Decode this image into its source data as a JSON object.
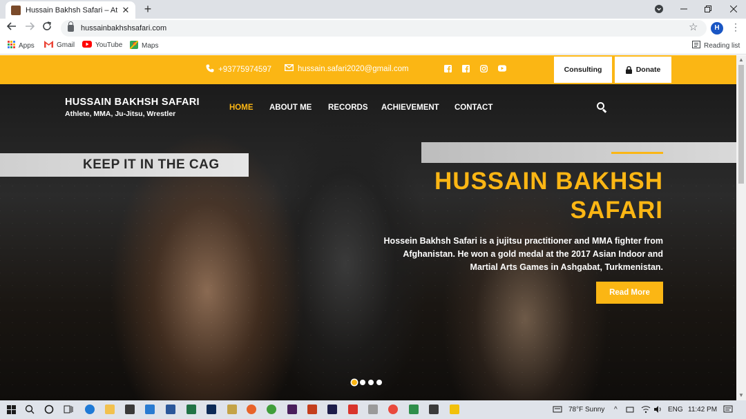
{
  "browser": {
    "tab_title": "Hussain Bakhsh Safari – Athlete, MMA, Ju-Jitsu, Wrestler",
    "tab_close": "✕",
    "new_tab": "+",
    "url": "hussainbakhshsafari.com",
    "profile_initial": "H",
    "bookmarks": [
      "Apps",
      "Gmail",
      "YouTube",
      "Maps"
    ],
    "reading_list": "Reading list"
  },
  "site": {
    "phone": "+93775974597",
    "email": "hussain.safari2020@gmail.com",
    "consulting_label": "Consulting",
    "donate_label": "Donate",
    "brand_name": "HUSSAIN BAKHSH SAFARI",
    "brand_tagline": "Athlete, MMA, Ju-Jitsu, Wrestler",
    "nav": [
      "HOME",
      "ABOUT ME",
      "RECORDS",
      "ACHIEVEMENT",
      "CONTACT"
    ],
    "hero_banner_text": "KEEP IT IN THE CAG",
    "hero_title_line1": "HUSSAIN BAKHSH",
    "hero_title_line2": "SAFARI",
    "hero_description": "Hossein Bakhsh Safari is a jujitsu practitioner and MMA fighter from Afghanistan. He won a gold medal at the 2017 Asian Indoor and Martial Arts Games in Ashgabat, Turkmenistan.",
    "read_more_label": "Read More",
    "slider_dots": 4,
    "active_slide": 1
  },
  "taskbar": {
    "weather": "78°F  Sunny",
    "language": "ENG",
    "time": "11:42 PM"
  },
  "colors": {
    "accent": "#fbb614",
    "dark": "#1b1b1b"
  }
}
